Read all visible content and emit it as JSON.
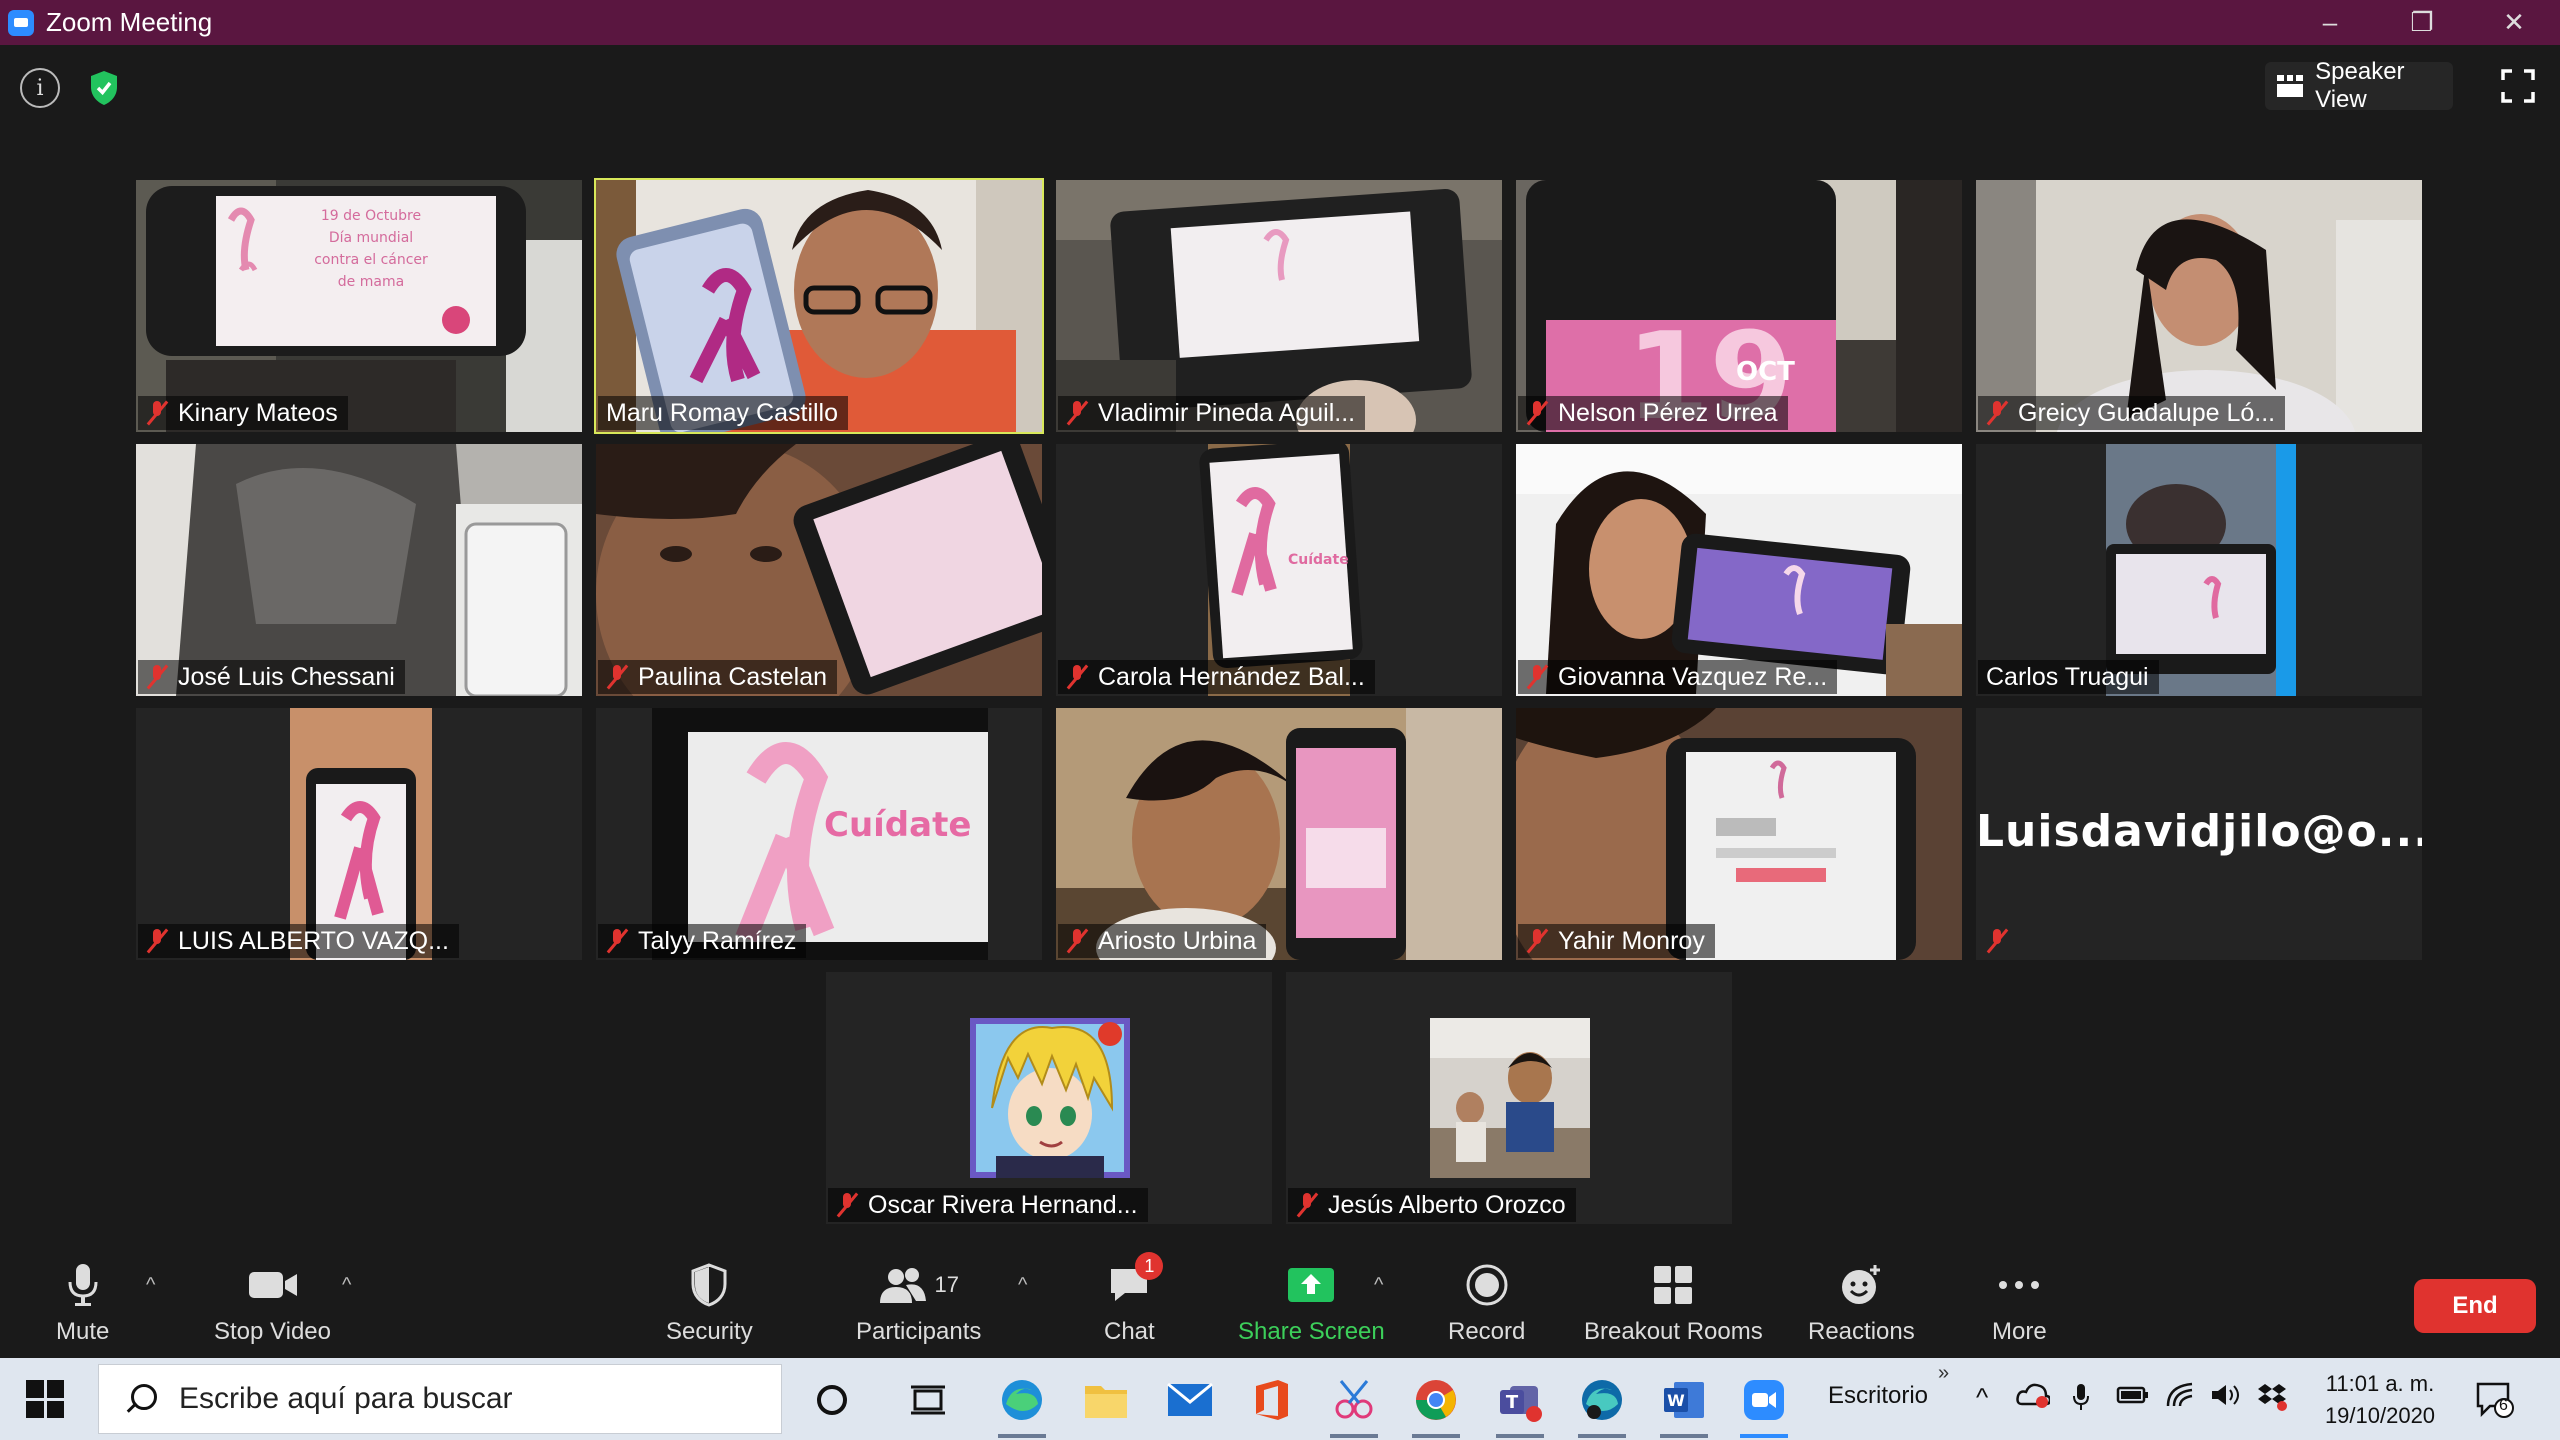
{
  "window": {
    "title": "Zoom Meeting",
    "controls": [
      "–",
      "❐",
      "✕"
    ]
  },
  "header": {
    "info_glyph": "i",
    "speaker_view_label": "Speaker View"
  },
  "participants": [
    {
      "name": "Kinary Mateos",
      "muted": true,
      "phone_text": "19 de Octubre Día mundial contra el cáncer de mama"
    },
    {
      "name": "Maru Romay Castillo",
      "muted": false,
      "active": true
    },
    {
      "name": "Vladimir Pineda Aguil...",
      "muted": true
    },
    {
      "name": "Nelson Pérez Urrea",
      "muted": true,
      "phone_text": "19 OCT"
    },
    {
      "name": "Greicy Guadalupe Ló...",
      "muted": true
    },
    {
      "name": "José Luis Chessani",
      "muted": true
    },
    {
      "name": "Paulina Castelan",
      "muted": true
    },
    {
      "name": "Carola Hernández Bal...",
      "muted": true
    },
    {
      "name": "Giovanna Vazquez Re...",
      "muted": true
    },
    {
      "name": "Carlos Truagui",
      "muted": false
    },
    {
      "name": "LUIS ALBERTO VAZQ...",
      "muted": true
    },
    {
      "name": "Talyy Ramírez",
      "muted": true,
      "screen_text": "Cuídate"
    },
    {
      "name": "Ariosto Urbina",
      "muted": true
    },
    {
      "name": "Yahir Monroy",
      "muted": true
    },
    {
      "name": "",
      "muted": true,
      "video_off_text": "Luisdavidjilo@o..."
    },
    {
      "name": "Oscar Rivera Hernand...",
      "muted": true
    },
    {
      "name": "Jesús Alberto Orozco",
      "muted": true
    }
  ],
  "toolbar": {
    "mute": "Mute",
    "stop_video": "Stop Video",
    "security": "Security",
    "participants": "Participants",
    "participants_count": "17",
    "chat": "Chat",
    "chat_badge": "1",
    "share_screen": "Share Screen",
    "record": "Record",
    "breakout_rooms": "Breakout Rooms",
    "reactions": "Reactions",
    "more": "More",
    "end": "End",
    "caret": "^"
  },
  "taskbar": {
    "search_placeholder": "Escribe aquí para buscar",
    "desktop_label": "Escritorio",
    "chevron": "»",
    "time": "11:01 a. m.",
    "date": "19/10/2020",
    "notification_count": "6",
    "tray_caret": "^",
    "apps": [
      "cortana-icon",
      "task-view-icon",
      "edge-icon",
      "file-explorer-icon",
      "mail-icon",
      "office-icon",
      "snip-icon",
      "chrome-icon",
      "teams-icon",
      "edge-dev-icon",
      "word-icon",
      "zoom-icon"
    ]
  },
  "colors": {
    "titlebar": "#5a1640",
    "active_speaker": "#d8e85a",
    "end_button": "#e0332f",
    "share_green": "#3ccf5a",
    "muted_red": "#e0332f"
  }
}
